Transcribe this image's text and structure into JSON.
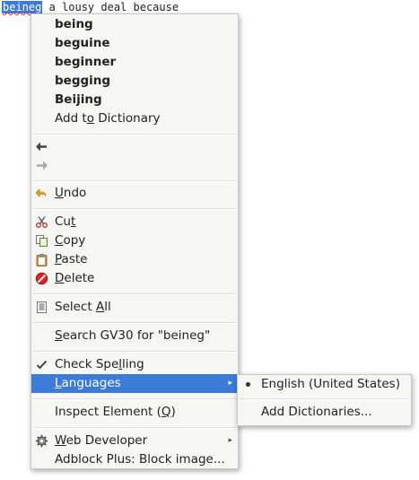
{
  "editor": {
    "misspelled_word": "beineg",
    "rest_of_line": " a lousy deal because"
  },
  "context_menu": {
    "suggestions": [
      "being",
      "beguine",
      "beginner",
      "begging",
      "Beijing"
    ],
    "add_to_dictionary": {
      "pre": "Add t",
      "mn": "o",
      "post": " Dictionary"
    },
    "back_icon": "arrow-left-icon",
    "forward_icon": "arrow-right-icon",
    "undo": {
      "pre": "",
      "mn": "U",
      "post": "ndo"
    },
    "cut": {
      "pre": "Cu",
      "mn": "t",
      "post": ""
    },
    "copy": {
      "pre": "",
      "mn": "C",
      "post": "opy"
    },
    "paste": {
      "pre": "",
      "mn": "P",
      "post": "aste"
    },
    "delete": {
      "pre": "",
      "mn": "D",
      "post": "elete"
    },
    "select_all": {
      "pre": "Select ",
      "mn": "A",
      "post": "ll"
    },
    "search": {
      "pre": "",
      "mn": "S",
      "post": "earch GV30 for \"beineg\""
    },
    "check_spelling": {
      "pre": "Check Spe",
      "mn": "l",
      "post": "ling"
    },
    "languages": {
      "pre": "",
      "mn": "L",
      "post": "anguages"
    },
    "inspect": {
      "pre": "Inspect Element (",
      "mn": "Q",
      "post": ")"
    },
    "web_developer": {
      "pre": "",
      "mn": "W",
      "post": "eb Developer"
    },
    "adblock": "Adblock Plus: Block image..."
  },
  "languages_submenu": {
    "english": "English (United States)",
    "add_dictionaries": {
      "pre": "",
      "mn": "A",
      "post": "dd Dictionaries..."
    }
  },
  "colors": {
    "selection": "#3d7bd9",
    "menu_bg": "#f6f6f5"
  }
}
